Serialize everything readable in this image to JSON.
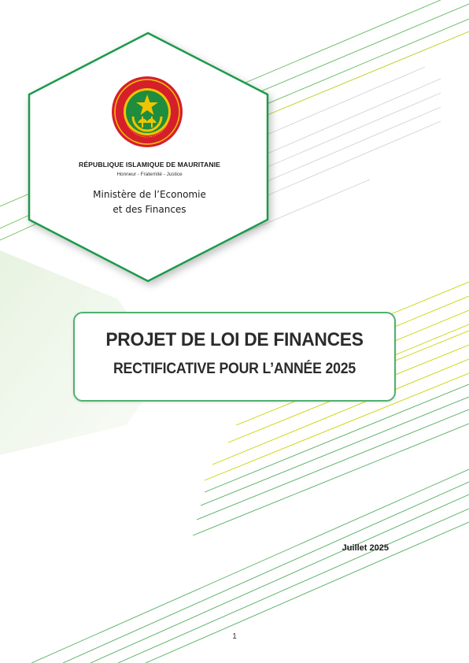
{
  "header": {
    "country": "RÉPUBLIQUE ISLAMIQUE DE MAURITANIE",
    "motto": "Honneur - Fraternité - Justice",
    "ministry_line1": "Ministère de l’Economie",
    "ministry_line2": "et des Finances"
  },
  "emblem": {
    "name": "national-seal-icon",
    "text_top": "الجمهورية الإسلامية الموريتانية",
    "text_bottom": "RÉPUBLIQUE ISLAMIQUE DE MAURITANIE"
  },
  "title": {
    "line1": "PROJET DE LOI DE FINANCES",
    "line2": "RECTIFICATIVE POUR L’ANNÉE 2025"
  },
  "date": "Juillet 2025",
  "page_number": "1",
  "colors": {
    "green": "#1f9a4b",
    "light_green": "#4fb26f",
    "yellow_green": "#c8d400",
    "pale_green": "#e8f3e2",
    "gray_line": "#cfcfcf"
  }
}
